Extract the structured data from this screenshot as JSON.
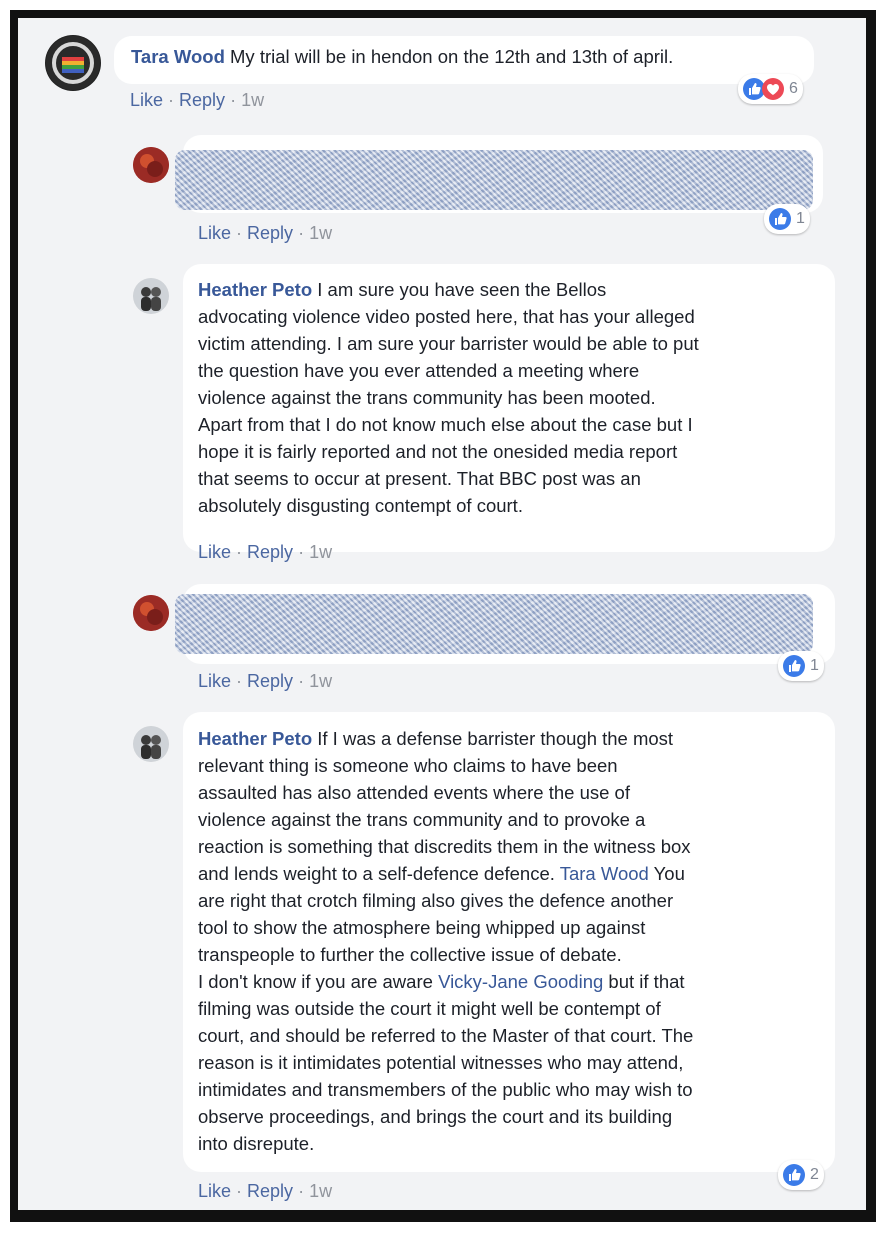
{
  "comments": [
    {
      "author": "Tara Wood",
      "text": " My trial will be in hendon on the 12th and 13th of april.",
      "reactions_count": "6",
      "actions": {
        "like": "Like",
        "reply": "Reply",
        "time": "1w",
        "sep": "·"
      }
    },
    {
      "author": "",
      "text": "",
      "reactions_count": "1",
      "actions": {
        "like": "Like",
        "reply": "Reply",
        "time": "1w",
        "sep": "·"
      }
    },
    {
      "author": "Heather Peto",
      "text_lines": [
        " I am sure you have seen the Bellos",
        "advocating violence video posted here, that has your alleged",
        "victim attending. I am sure your barrister would be able to put",
        "the question have you ever attended a meeting where",
        "violence against the trans community has been mooted.",
        "Apart from that I do not know much else about the case but I",
        "hope it is fairly reported and not the onesided media report",
        "that seems to occur at present. That BBC post was an",
        "absolutely disgusting contempt of court."
      ],
      "actions": {
        "like": "Like",
        "reply": "Reply",
        "time": "1w",
        "sep": "·"
      }
    },
    {
      "author": "",
      "text": "",
      "reactions_count": "1",
      "actions": {
        "like": "Like",
        "reply": "Reply",
        "time": "1w",
        "sep": "·"
      }
    },
    {
      "author": "Heather Peto",
      "line1": " If I was a defense barrister though the most",
      "lines_a": [
        "relevant thing is someone who claims to have been",
        "assaulted has also attended events where the use of",
        "violence against the trans community and to provoke a",
        "reaction is something that discredits them in the witness box",
        "and lends weight to a self-defence defence."
      ],
      "mention1": "Tara Wood",
      "after_mention1": " You",
      "lines_b": [
        "are right that crotch filming also gives the defence another",
        "tool to show the atmosphere being whipped up against",
        "transpeople to further the collective issue of debate."
      ],
      "before_mention2": "I don't know if you are aware ",
      "mention2": "Vicky-Jane Gooding",
      "after_mention2": " but if that",
      "lines_c": [
        "filming was outside the court it might well be contempt of",
        "court, and should be referred to the Master of that court. The",
        "reason is it intimidates potential witnesses who may attend,",
        "intimidates and transmembers of the public who may wish to",
        "observe proceedings, and brings the court and its building",
        "into disrepute."
      ],
      "reactions_count": "2",
      "actions": {
        "like": "Like",
        "reply": "Reply",
        "time": "1w",
        "sep": "·"
      }
    }
  ],
  "colors": {
    "like_blue": "#3b7be8",
    "love_red": "#ed4956",
    "link": "#385898",
    "meta": "#90949c"
  },
  "icons": [
    "antifa-avatar",
    "like-icon",
    "love-icon",
    "user-avatar"
  ]
}
